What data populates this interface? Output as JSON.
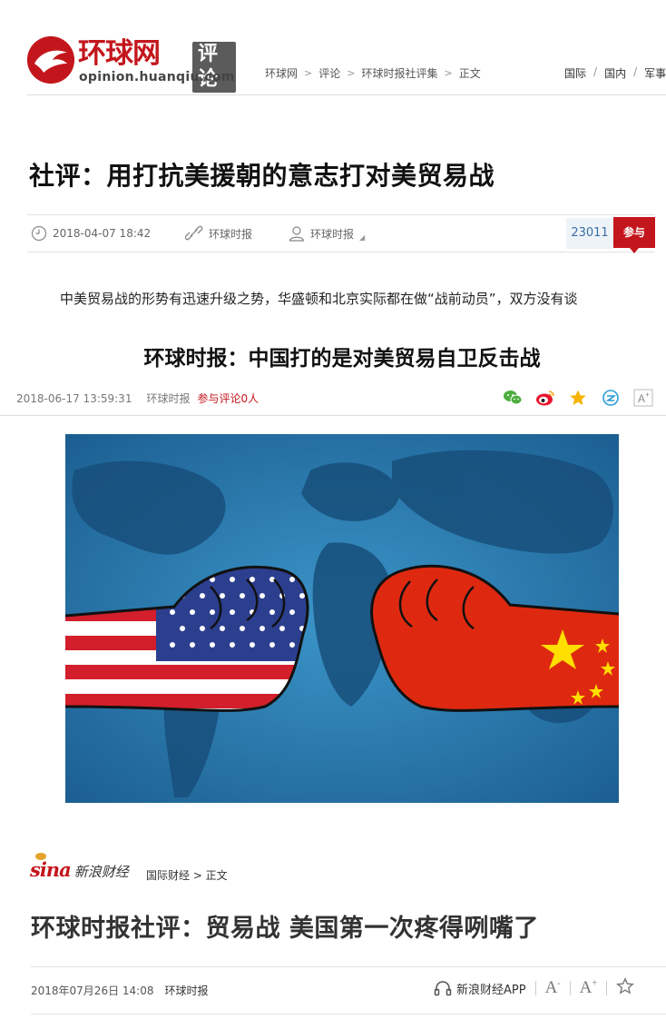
{
  "header": {
    "logo_name": "环球网",
    "logo_badge": "评论",
    "logo_url": "opinion.huanqiu.com",
    "breadcrumb": [
      "环球网",
      "评论",
      "环球时报社评集",
      "正文"
    ],
    "nav": [
      "国际",
      "国内",
      "军事"
    ]
  },
  "article1": {
    "title": "社评：用打抗美援朝的意志打对美贸易战",
    "datetime": "2018-04-07 18:42",
    "source": "环球时报",
    "author": "环球时报",
    "comment_count": "23011",
    "join_label": "参与",
    "summary": "中美贸易战的形势有迅速升级之势，华盛顿和北京实际都在做“战前动员”，双方没有谈"
  },
  "article2": {
    "title": "环球时报：中国打的是对美贸易自卫反击战",
    "datetime": "2018-06-17 13:59:31",
    "source": "环球时报",
    "comment_link": "参与评论0人",
    "share_icons": [
      "wechat-icon",
      "weibo-icon",
      "favorite-star-icon",
      "qzone-icon",
      "font-size-icon"
    ]
  },
  "hero_image": {
    "description_icon": "us-china-fists-image"
  },
  "article3": {
    "site_logo": "sina",
    "site_name": "新浪财经",
    "breadcrumb": "国际财经 > 正文",
    "title": "环球时报社评：贸易战 美国第一次疼得咧嘴了",
    "datetime": "2018年07月26日 14:08",
    "source": "环球时报",
    "app_label": "新浪财经APP",
    "tool_decrease": "A",
    "tool_increase": "A"
  },
  "colors": {
    "brand_red": "#c3161c",
    "count_blue": "#3a6ea5",
    "ocean": "#2f7fb6"
  }
}
